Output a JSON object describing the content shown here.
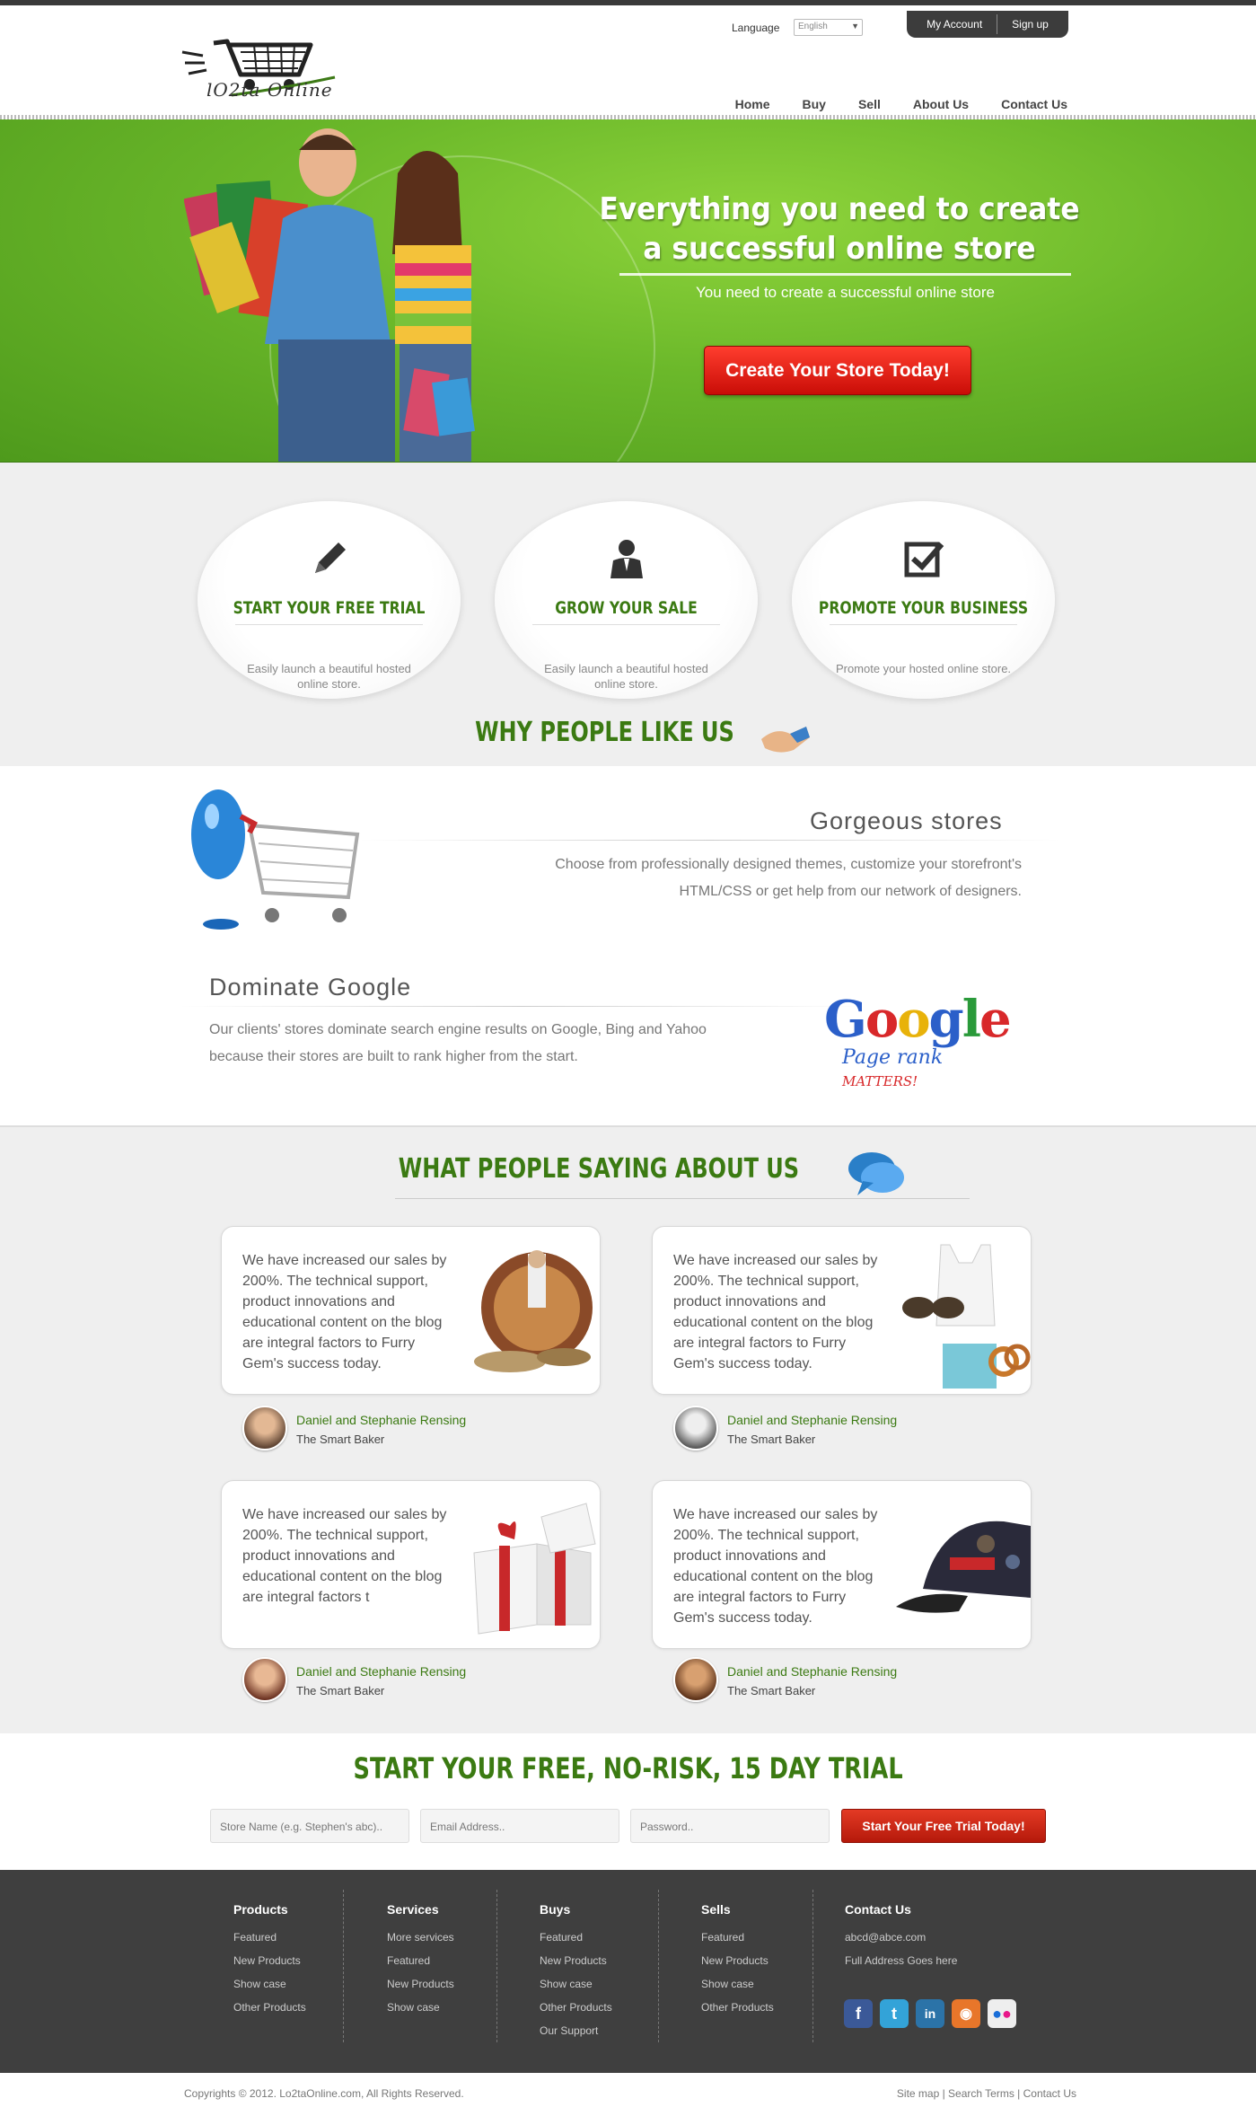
{
  "header": {
    "logo_text": "lO2ta Online",
    "language_label": "Language",
    "language_value": "English",
    "my_account": "My Account",
    "sign_up": "Sign up",
    "nav": [
      "Home",
      "Buy",
      "Sell",
      "About Us",
      "Contact Us"
    ]
  },
  "hero": {
    "title_line1": "Everything you need to create",
    "title_line2": "a successful online store",
    "subtitle": "You need to create a successful online store",
    "cta": "Create Your Store Today!"
  },
  "features": [
    {
      "icon": "pencil-icon",
      "title": "START YOUR FREE TRIAL",
      "desc": "Easily launch a beautiful hosted online store."
    },
    {
      "icon": "businessman-icon",
      "title": "GROW YOUR SALE",
      "desc": "Easily launch a beautiful hosted online store."
    },
    {
      "icon": "checkbox-icon",
      "title": "PROMOTE YOUR BUSINESS",
      "desc": "Promote your hosted online store."
    }
  ],
  "why_title": "WHY PEOPLE LIKE US",
  "stores": {
    "gorgeous_title": "Gorgeous stores",
    "gorgeous_desc_1": "Choose from professionally designed themes, customize your storefront's",
    "gorgeous_desc_2": "HTML/CSS or get help from our network of designers.",
    "dominate_title": "Dominate Google",
    "dominate_desc_1": "Our clients' stores dominate search engine results on Google, Bing and Yahoo",
    "dominate_desc_2": "because their stores are built to rank higher from the start.",
    "google_word": "Google",
    "page_rank": "Page rank",
    "matters": "MATTERS!"
  },
  "testimonials_title": "WHAT PEOPLE SAYING ABOUT US",
  "testimonials": [
    {
      "text": "We have increased our sales by 200%. The technical support, product innovations and educational content on the blog are integral factors to Furry Gem's success today.",
      "name": "Daniel and Stephanie Rensing",
      "company": "The Smart Baker"
    },
    {
      "text": "We have increased our sales by 200%. The technical support, product innovations and educational content on the blog are integral factors to Furry Gem's success today.",
      "name": "Daniel and Stephanie Rensing",
      "company": "The Smart Baker"
    },
    {
      "text": "We have increased our sales by 200%. The technical support, product innovations and educational content on the blog are integral factors t",
      "name": "Daniel and Stephanie Rensing",
      "company": "The Smart Baker"
    },
    {
      "text": "We have increased our sales by 200%. The technical support, product innovations and educational content on the blog are integral factors to Furry Gem's success today.",
      "name": "Daniel and Stephanie Rensing",
      "company": "The Smart Baker"
    }
  ],
  "trial": {
    "title": "START YOUR FREE, NO-RISK, 15 DAY TRIAL",
    "store_placeholder": "Store Name  (e.g. Stephen's abc)..",
    "email_placeholder": "Email Address..",
    "password_placeholder": "Password..",
    "button": "Start Your Free Trial Today!"
  },
  "footer": {
    "columns": [
      {
        "title": "Products",
        "items": [
          "Featured",
          "New Products",
          "Show case",
          "Other Products"
        ]
      },
      {
        "title": "Services",
        "items": [
          "More services",
          "Featured",
          "New Products",
          "Show case"
        ]
      },
      {
        "title": "Buys",
        "items": [
          "Featured",
          "New Products",
          "Show case",
          "Other Products",
          "Our Support"
        ]
      },
      {
        "title": "Sells",
        "items": [
          "Featured",
          "New Products",
          "Show case",
          "Other Products"
        ]
      },
      {
        "title": "Contact Us",
        "items": [
          "abcd@abce.com",
          "Full Address Goes here"
        ]
      }
    ],
    "copyright": "Copyrights © 2012. Lo2taOnline.com, All Rights Reserved.",
    "bottom_links": "Site map | Search Terms | Contact Us"
  },
  "colors": {
    "accent_green": "#3b7a12",
    "cta_red": "#d81a0c",
    "footer_bg": "#3f3f3f"
  }
}
